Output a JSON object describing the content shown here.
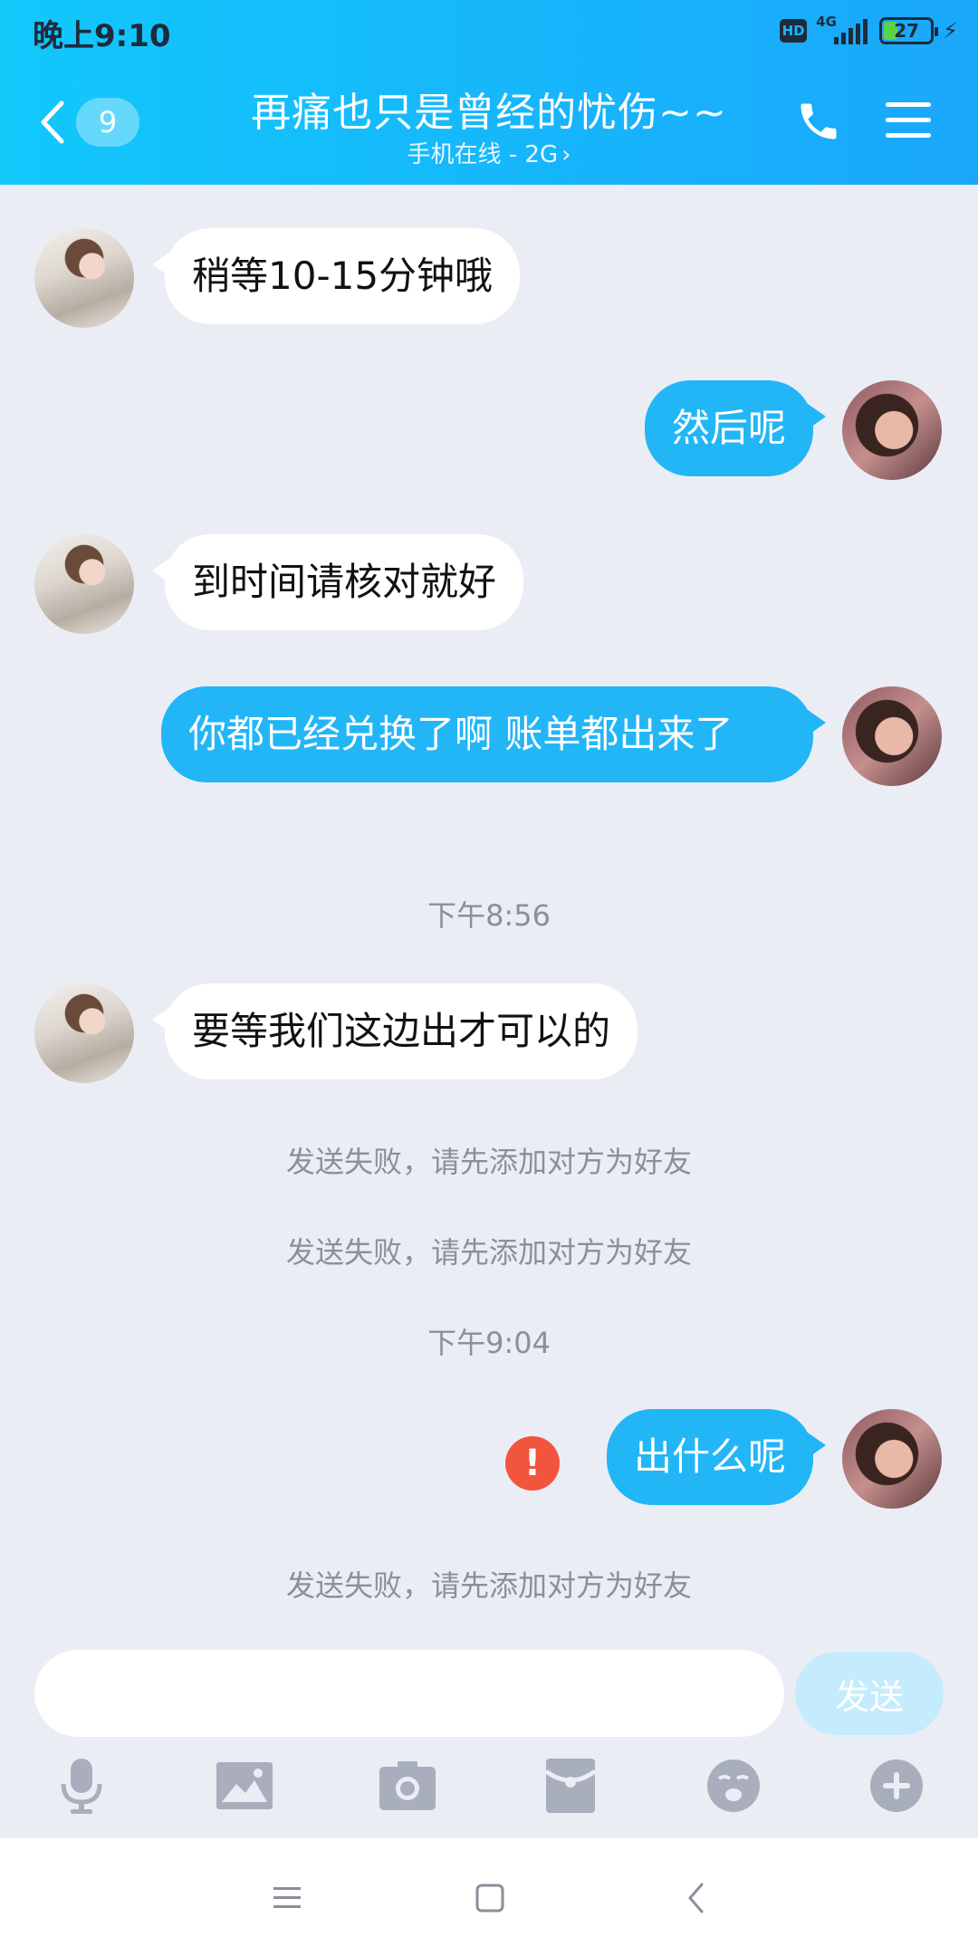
{
  "status_bar": {
    "time": "晚上9:10",
    "hd": "HD",
    "network": "4G",
    "battery": "27",
    "battery_level": 0.27
  },
  "header": {
    "unread_count": "9",
    "title": "再痛也只是曾经的忧伤~~",
    "subtitle": "手机在线 - 2G",
    "subtitle_chevron": "›",
    "icons": [
      "back-chevron-icon",
      "phone-icon",
      "menu-icon"
    ]
  },
  "messages": [
    {
      "direction": "in",
      "text": "稍等10-15分钟哦"
    },
    {
      "direction": "out",
      "text": "然后呢"
    },
    {
      "direction": "in",
      "text": "到时间请核对就好"
    },
    {
      "direction": "out",
      "text": "你都已经兑换了啊 账单都出来了"
    },
    {
      "type": "time",
      "text": "下午8:56"
    },
    {
      "direction": "in",
      "text": "要等我们这边出才可以的"
    },
    {
      "type": "system",
      "text": "发送失败，请先添加对方为好友"
    },
    {
      "type": "system",
      "text": "发送失败，请先添加对方为好友"
    },
    {
      "type": "time",
      "text": "下午9:04"
    },
    {
      "direction": "out",
      "text": "出什么呢",
      "failed": true,
      "failed_icon": "!"
    },
    {
      "type": "system",
      "text": "发送失败，请先添加对方为好友"
    }
  ],
  "composer": {
    "input_value": "",
    "send_label": "发送"
  },
  "toolbar": {
    "icons": [
      "microphone-icon",
      "image-icon",
      "camera-icon",
      "red-packet-icon",
      "emoji-icon",
      "plus-icon"
    ]
  },
  "colors": {
    "header_start": "#12c8fb",
    "header_end": "#1aa7fb",
    "outgoing_bubble": "#22b6f7",
    "incoming_bubble": "#ffffff",
    "background": "#ebedf5",
    "error": "#f2553d"
  }
}
